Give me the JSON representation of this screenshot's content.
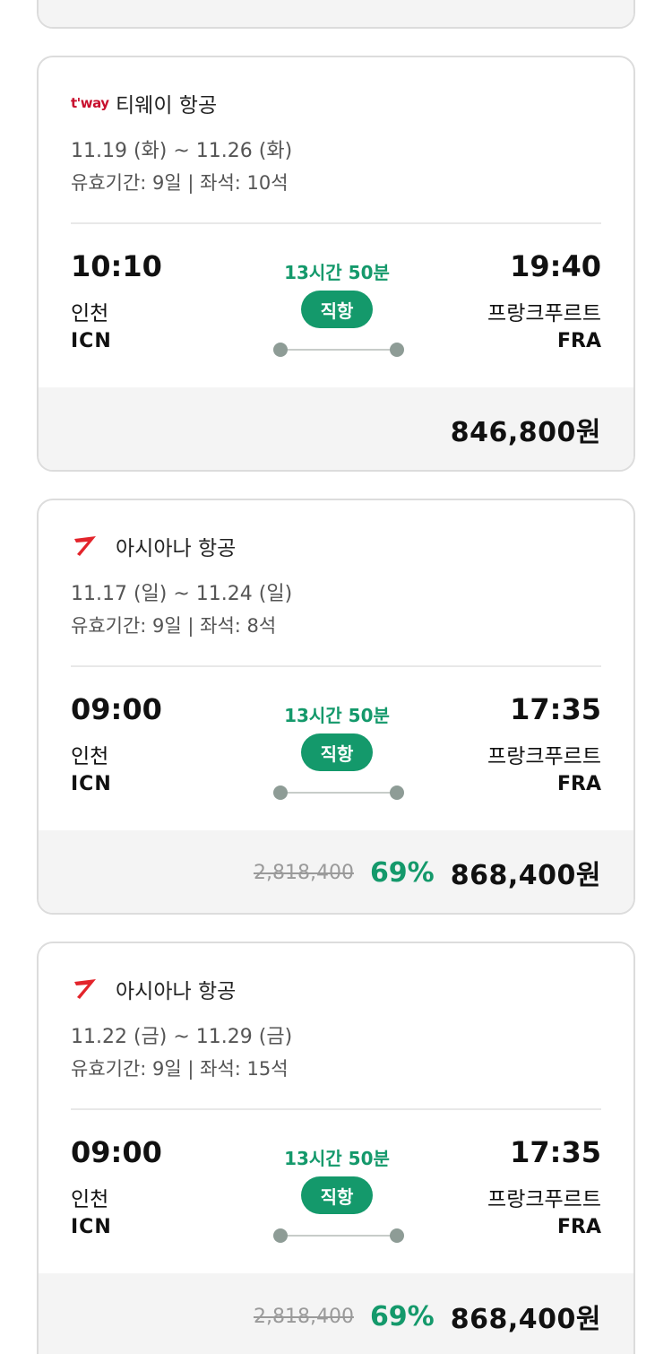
{
  "flights": [
    {
      "airline": "티웨이 항공",
      "logo_text": "t'way",
      "logo_icon": "tway-logo-icon",
      "dates": "11.19 (화) ~ 11.26 (화)",
      "validity": "유효기간: 9일 | 좌석: 10석",
      "departure": {
        "time": "10:10",
        "city": "인천",
        "code": "ICN"
      },
      "arrival": {
        "time": "19:40",
        "city": "프랑크푸르트",
        "code": "FRA"
      },
      "duration": "13시간 50분",
      "direct_label": "직항",
      "original_price": "",
      "discount": "",
      "price": "846,800원"
    },
    {
      "airline": "아시아나 항공",
      "logo_icon": "asiana-logo-icon",
      "dates": "11.17 (일) ~ 11.24 (일)",
      "validity": "유효기간: 9일 | 좌석: 8석",
      "departure": {
        "time": "09:00",
        "city": "인천",
        "code": "ICN"
      },
      "arrival": {
        "time": "17:35",
        "city": "프랑크푸르트",
        "code": "FRA"
      },
      "duration": "13시간 50분",
      "direct_label": "직항",
      "original_price": "2,818,400",
      "discount": "69%",
      "price": "868,400원"
    },
    {
      "airline": "아시아나 항공",
      "logo_icon": "asiana-logo-icon",
      "dates": "11.22 (금) ~ 11.29 (금)",
      "validity": "유효기간: 9일 | 좌석: 15석",
      "departure": {
        "time": "09:00",
        "city": "인천",
        "code": "ICN"
      },
      "arrival": {
        "time": "17:35",
        "city": "프랑크푸르트",
        "code": "FRA"
      },
      "duration": "13시간 50분",
      "direct_label": "직항",
      "original_price": "2,818,400",
      "discount": "69%",
      "price": "868,400원"
    }
  ],
  "colors": {
    "accent_green": "#14996b",
    "card_border": "#dcdcdc",
    "footer_bg": "#f4f4f4",
    "asiana_red": "#e3242b",
    "tway_red": "#c8102e"
  }
}
